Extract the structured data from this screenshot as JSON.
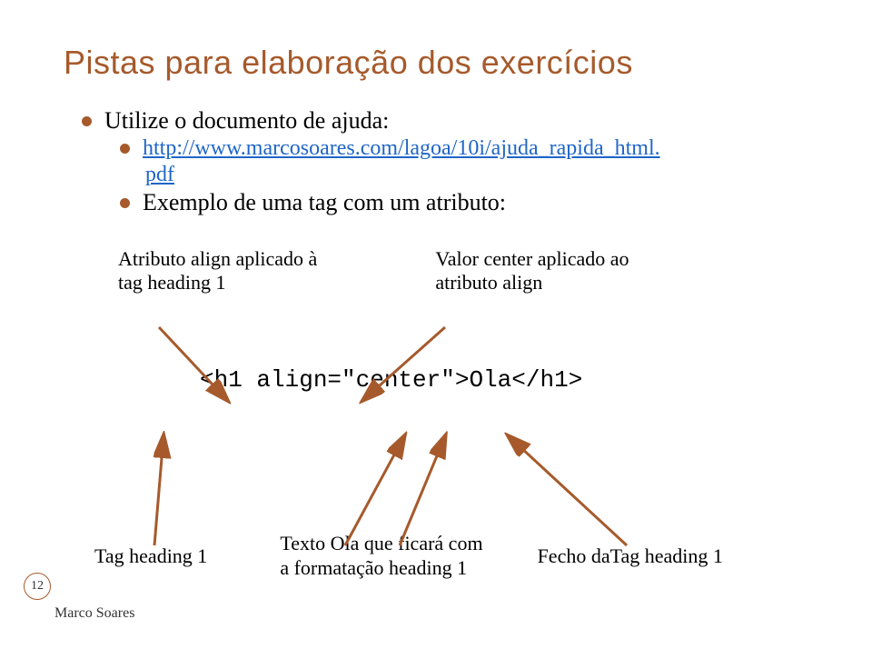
{
  "title": "Pistas para elaboração dos exercícios",
  "bullet1": "Utilize o documento de ajuda:",
  "link_line1": "http://www.marcosoares.com/lagoa/10i/ajuda_rapida_html.",
  "link_line2": "pdf",
  "bullet2": "Exemplo de uma tag com um atributo:",
  "annot_left_l1": "Atributo align aplicado à",
  "annot_left_l2": "tag heading 1",
  "annot_right_l1": "Valor center aplicado ao",
  "annot_right_l2": "atributo align",
  "code": "<h1 align=\"center\">Ola</h1>",
  "bottom_tag": "Tag heading 1",
  "bottom_text_l1": "Texto Ola que ficará com",
  "bottom_text_l2": "a formatação heading 1",
  "bottom_close": "Fecho daTag heading 1",
  "page_num": "12",
  "footer": "Marco Soares"
}
